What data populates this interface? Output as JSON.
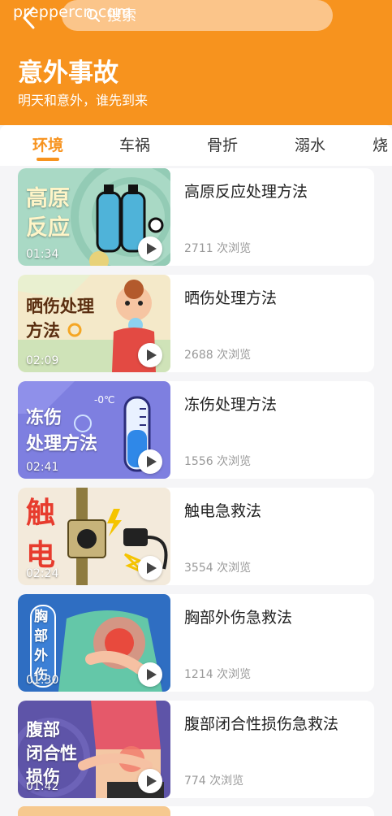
{
  "header": {
    "watermark": "prepperc​n.com",
    "search_placeholder": "搜索",
    "title": "意外事故",
    "subtitle": "明天和意外，谁先到来",
    "bg_color": "#f7931e"
  },
  "tabs": [
    {
      "label": "环境",
      "active": true
    },
    {
      "label": "车祸",
      "active": false
    },
    {
      "label": "骨折",
      "active": false
    },
    {
      "label": "溺水",
      "active": false
    },
    {
      "label": "烧",
      "active": false
    }
  ],
  "videos": [
    {
      "title": "高原反应处理方法",
      "views": "2711 次浏览",
      "duration": "01:34",
      "thumb_text": [
        "高原",
        "反应"
      ]
    },
    {
      "title": "晒伤处理方法",
      "views": "2688 次浏览",
      "duration": "02:09",
      "thumb_text": [
        "晒伤处理",
        "方法"
      ]
    },
    {
      "title": "冻伤处理方法",
      "views": "1556 次浏览",
      "duration": "02:41",
      "thumb_text": [
        "冻伤",
        "处理方法"
      ],
      "thumb_note": "-0℃"
    },
    {
      "title": "触电急救法",
      "views": "3554 次浏览",
      "duration": "02:24",
      "thumb_text": [
        "触",
        "电"
      ]
    },
    {
      "title": "胸部外伤急救法",
      "views": "1214 次浏览",
      "duration": "01:30",
      "thumb_text": [
        "胸",
        "部",
        "外",
        "伤"
      ]
    },
    {
      "title": "腹部闭合性损伤急救法",
      "views": "774 次浏览",
      "duration": "01:42",
      "thumb_text": [
        "腹部",
        "闭合性",
        "损伤"
      ]
    }
  ]
}
